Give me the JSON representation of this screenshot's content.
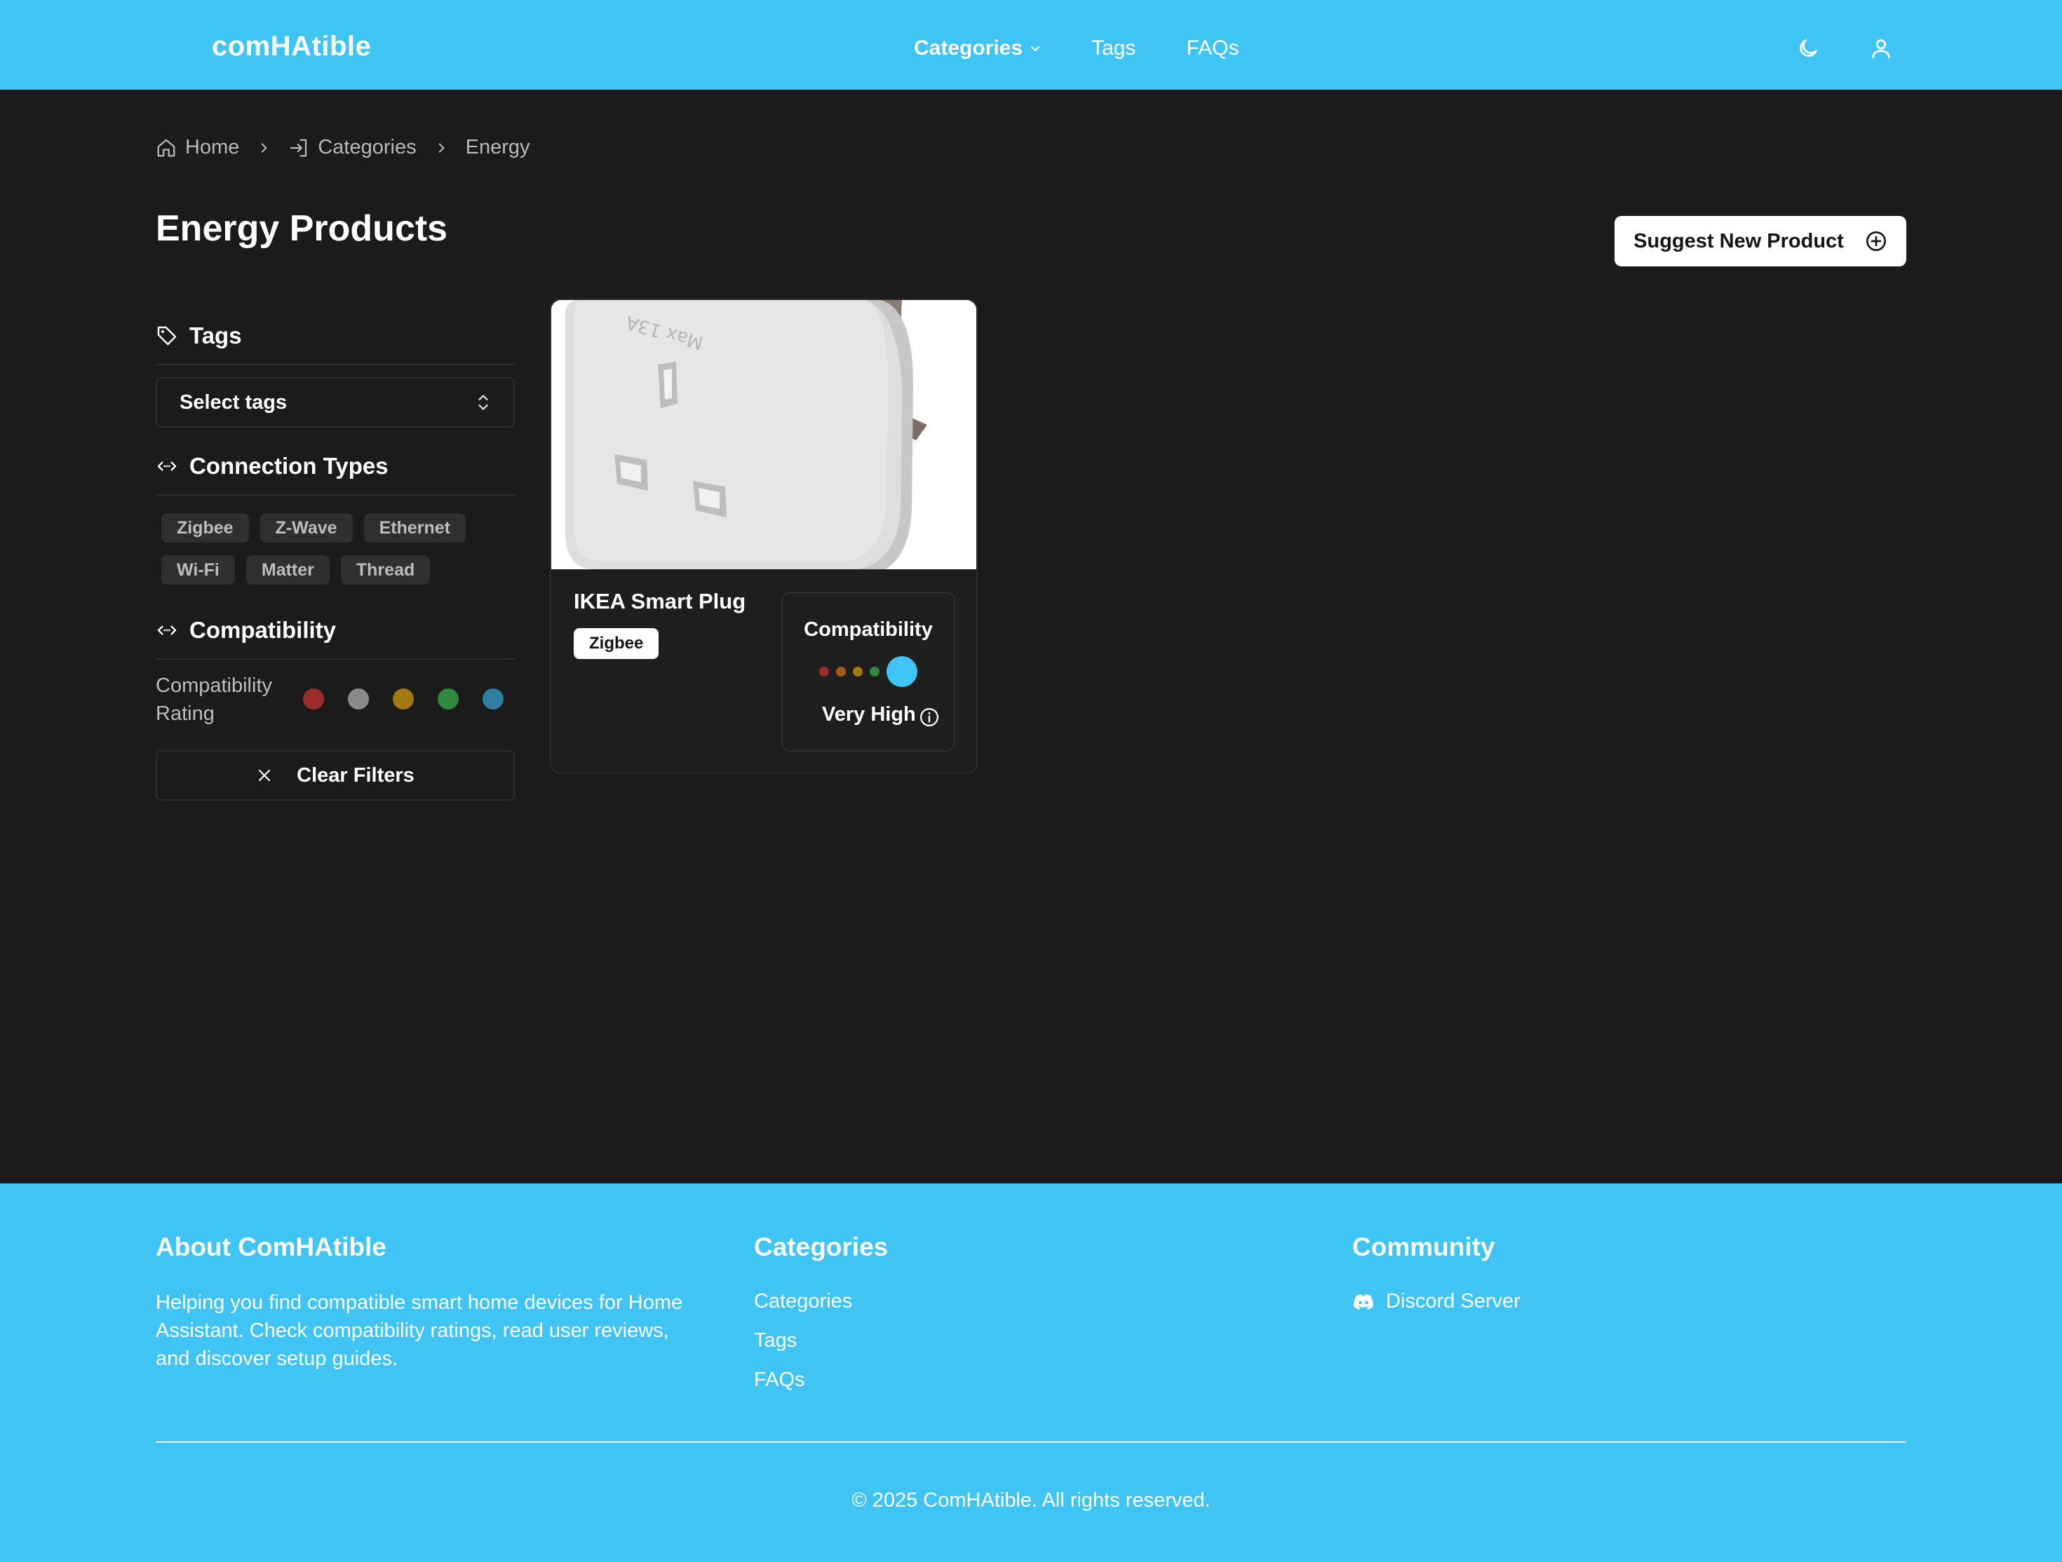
{
  "colors": {
    "brand": "#40c4f4",
    "background": "#1b1b1b",
    "rating_red": "#9b2c2c",
    "rating_gray": "#8a8a8a",
    "rating_amber": "#a47812",
    "rating_green": "#2f8a3e",
    "rating_blue": "#2f7fa0"
  },
  "header": {
    "logo": "comHAtible",
    "nav": {
      "categories": "Categories",
      "tags": "Tags",
      "faqs": "FAQs"
    },
    "icons": [
      "moon-icon",
      "user-icon"
    ]
  },
  "breadcrumb": {
    "home": "Home",
    "categories": "Categories",
    "current": "Energy"
  },
  "page": {
    "title": "Energy Products",
    "suggest_button": "Suggest New Product"
  },
  "sidebar": {
    "tags_heading": "Tags",
    "tags_select_placeholder": "Select tags",
    "connection_heading": "Connection Types",
    "connection_types_row1": [
      "Zigbee",
      "Z-Wave",
      "Ethernet"
    ],
    "connection_types_row2": [
      "Wi-Fi",
      "Matter",
      "Thread"
    ],
    "compatibility_heading": "Compatibility",
    "rating_label_line1": "Compatibility",
    "rating_label_line2": "Rating",
    "clear_filters": "Clear Filters"
  },
  "products": [
    {
      "name": "IKEA Smart Plug",
      "tag": "Zigbee",
      "compatibility_title": "Compatibility",
      "compatibility_level": "Very High",
      "compatibility_rating": 5,
      "compatibility_max": 5
    }
  ],
  "footer": {
    "about_heading": "About ComHAtible",
    "about_text": "Helping you find compatible smart home devices for Home Assistant. Check compatibility ratings, read user reviews, and discover setup guides.",
    "categories_heading": "Categories",
    "links": {
      "categories": "Categories",
      "tags": "Tags",
      "faqs": "FAQs"
    },
    "community_heading": "Community",
    "discord": "Discord Server",
    "copyright": "© 2025 ComHAtible. All rights reserved."
  }
}
